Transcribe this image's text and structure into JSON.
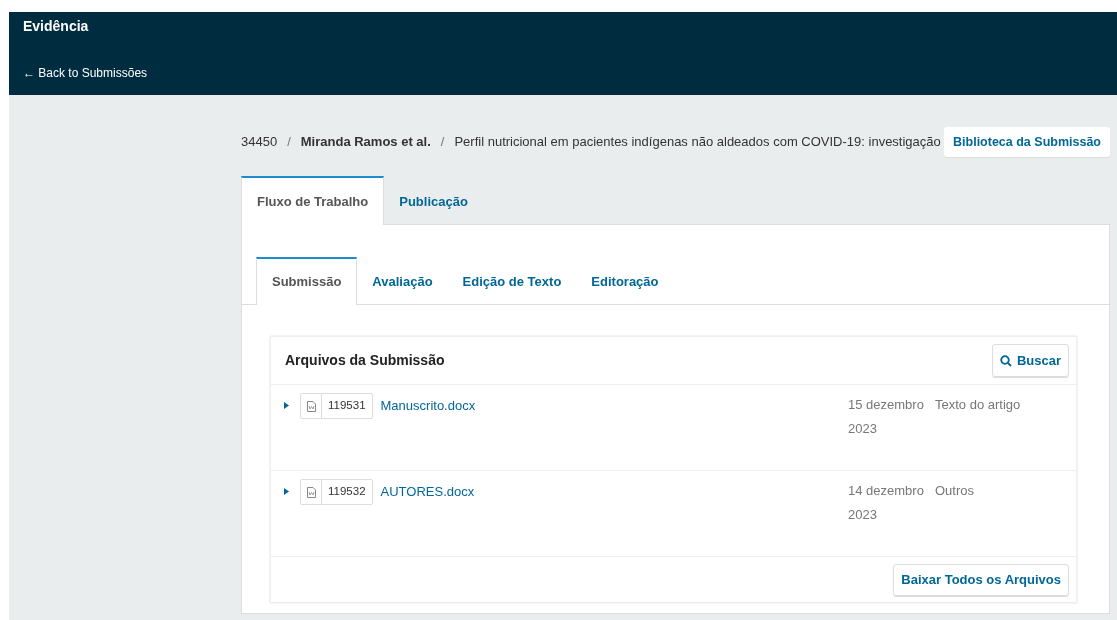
{
  "header": {
    "title": "Evidência",
    "back_link": "← Back to Submissões"
  },
  "breadcrumb": {
    "id": "34450",
    "separator": "/",
    "authors": "Miranda Ramos et al.",
    "title": "Perfil nutricional em pacientes indígenas não aldeados com COVID-19: investigação"
  },
  "library_button": "Biblioteca da Submissão",
  "tabs": [
    {
      "label": "Fluxo de Trabalho",
      "selected": true
    },
    {
      "label": "Publicação",
      "selected": false
    }
  ],
  "stage_tabs": [
    {
      "label": "Submissão",
      "selected": true
    },
    {
      "label": "Avaliação",
      "selected": false
    },
    {
      "label": "Edição de Texto",
      "selected": false
    },
    {
      "label": "Editoração",
      "selected": false
    }
  ],
  "files_panel": {
    "title": "Arquivos da Submissão",
    "search_button": "Buscar",
    "files": [
      {
        "id": "119531",
        "name": "Manuscrito.docx",
        "date": "15 dezembro 2023",
        "type": "Texto do artigo",
        "expanded": false
      },
      {
        "id": "119532",
        "name": "AUTORES.docx",
        "date": "14 dezembro 2023",
        "type": "Outros",
        "expanded": false
      }
    ],
    "download_button": "Baixar Todos os Arquivos"
  }
}
